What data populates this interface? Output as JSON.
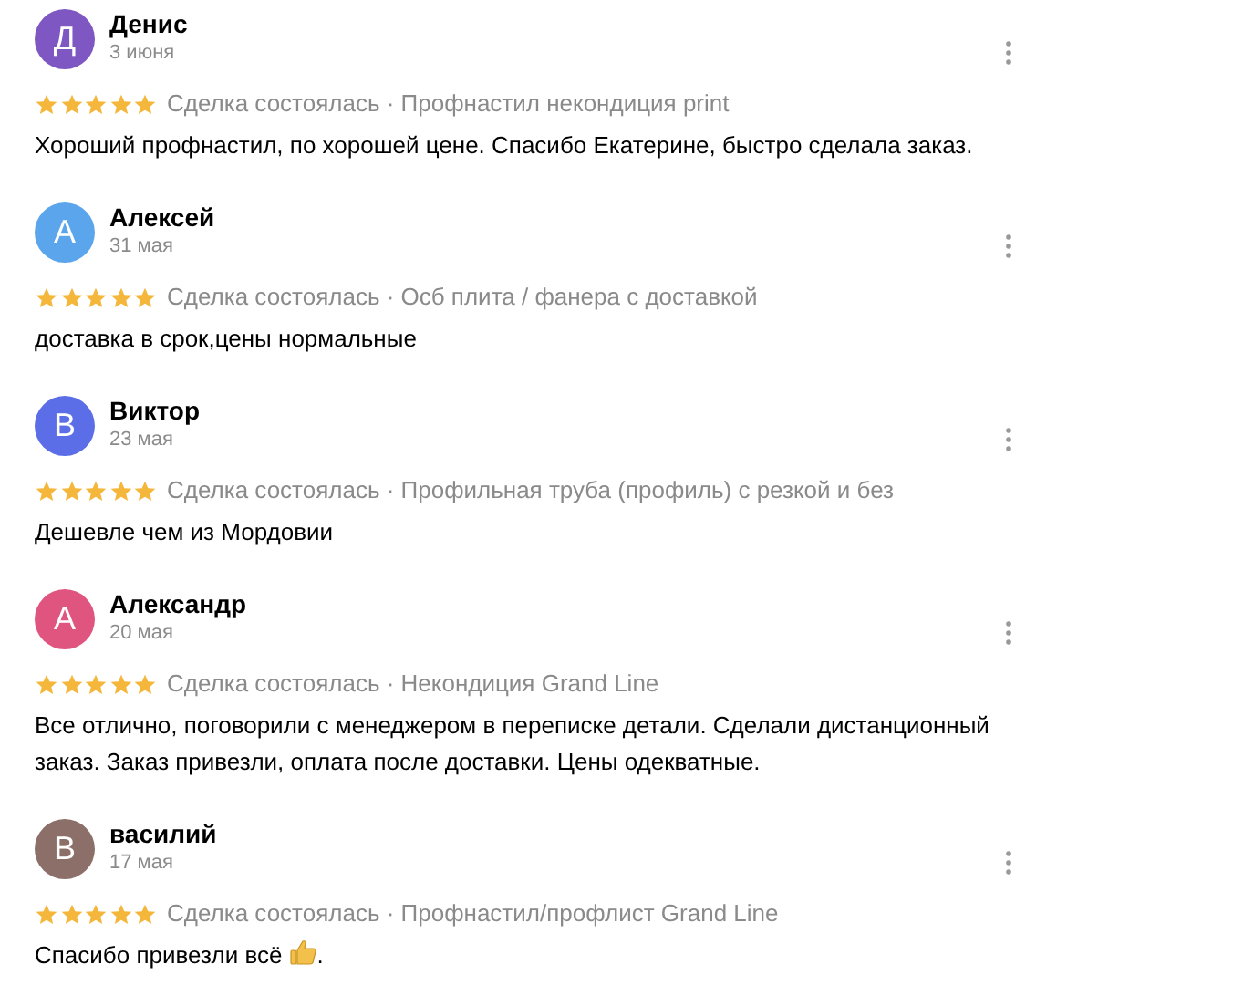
{
  "reviews": [
    {
      "initial": "Д",
      "color": "#7e57c2",
      "name": "Денис",
      "date": "3 июня",
      "stars": 5,
      "meta": "Сделка состоялась · Профнастил некондиция print",
      "text": "Хороший профнастил, по хорошей цене. Спасибо Екатерине, быстро сделала заказ."
    },
    {
      "initial": "А",
      "color": "#5aa5ec",
      "name": "Алексей",
      "date": "31 мая",
      "stars": 5,
      "meta": "Сделка состоялась · Осб плита / фанера с доставкой",
      "text": "доставка в срок,цены нормальные"
    },
    {
      "initial": "В",
      "color": "#5b6ee8",
      "name": "Виктор",
      "date": "23 мая",
      "stars": 5,
      "meta": "Сделка состоялась · Профильная труба (профиль) с резкой и без",
      "text": "Дешевле чем из Мордовии"
    },
    {
      "initial": "А",
      "color": "#e0557f",
      "name": "Александр",
      "date": "20 мая",
      "stars": 5,
      "meta": "Сделка состоялась · Некондиция Grand Line",
      "text": "Все отлично, поговорили с менеджером в переписке детали. Сделали дистанционный заказ. Заказ привезли, оплата после доставки. Цены одекватные."
    },
    {
      "initial": "В",
      "color": "#8c6f68",
      "name": "василий",
      "date": "17 мая",
      "stars": 5,
      "meta": "Сделка состоялась · Профнастил/профлист Grand Line",
      "text": "Спасибо привезли всё",
      "thumbs_emoji": true,
      "text_after": "."
    }
  ]
}
